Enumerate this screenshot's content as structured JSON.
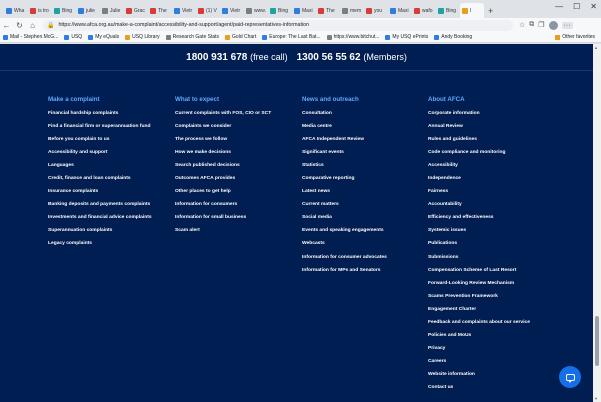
{
  "browser": {
    "tabs": [
      {
        "label": "Wha",
        "color": "#2f7de1"
      },
      {
        "label": "is tro",
        "color": "#d93b3b"
      },
      {
        "label": "Bing",
        "color": "#1fa2a2"
      },
      {
        "label": "julie",
        "color": "#2f7de1"
      },
      {
        "label": "Julie",
        "color": "#7d7d7d"
      },
      {
        "label": "Grac",
        "color": "#d93b3b"
      },
      {
        "label": "The",
        "color": "#d93b3b"
      },
      {
        "label": "Vietr",
        "color": "#2f7de1"
      },
      {
        "label": "(1) V",
        "color": "#d93b3b"
      },
      {
        "label": "Vietr",
        "color": "#2f7de1"
      },
      {
        "label": "www.",
        "color": "#7d7d7d"
      },
      {
        "label": "Bing",
        "color": "#1fa2a2"
      },
      {
        "label": "Maxi",
        "color": "#2f7de1"
      },
      {
        "label": "The",
        "color": "#d93b3b"
      },
      {
        "label": "mem",
        "color": "#7d7d7d"
      },
      {
        "label": "you",
        "color": "#d93b3b"
      },
      {
        "label": "Maxi",
        "color": "#2f7de1"
      },
      {
        "label": "wafo",
        "color": "#d93b3b"
      },
      {
        "label": "Bing",
        "color": "#1fa2a2"
      },
      {
        "label": "I",
        "color": "#e6a11a",
        "active": true
      }
    ],
    "new_tab": "+",
    "window_controls": {
      "minimize": "—",
      "maximize": "☐",
      "close": "✕"
    },
    "nav": {
      "back": "←",
      "refresh": "↻",
      "home": "⌂",
      "lock": "🔒"
    },
    "url": "https://www.afca.org.au/make-a-complaint/accessibility-and-support/agent/paid-representatives-information",
    "nav_right": {
      "star": "☆",
      "ext": "⧉",
      "collections": "❐",
      "more": "···"
    },
    "bookmarks": [
      {
        "label": "Mail - Stephen.McG...",
        "color": "#2f7de1"
      },
      {
        "label": "USQ",
        "color": "#2f7de1"
      },
      {
        "label": "My eQuals",
        "color": "#2f7de1"
      },
      {
        "label": "USQ Library",
        "color": "#e6a11a"
      },
      {
        "label": "Research Gate Stats",
        "color": "#7d7d7d"
      },
      {
        "label": "Gold Chart",
        "color": "#e6a11a"
      },
      {
        "label": "Europe: The Last Bat...",
        "color": "#2f7de1"
      },
      {
        "label": "https://www.bitchut...",
        "color": "#7d7d7d"
      },
      {
        "label": "My USQ ePrints",
        "color": "#2f7de1"
      },
      {
        "label": "Andy Booking",
        "color": "#2f7de1"
      }
    ],
    "other_favorites": "Other favorites"
  },
  "footer": {
    "phones": {
      "free_number": "1800 931 678",
      "free_label": "(free call)",
      "members_number": "1300 56 55 62",
      "members_label": "(Members)"
    },
    "columns": [
      {
        "heading": "Make a complaint",
        "links": [
          "Financial hardship complaints",
          "Find a financial firm or superannuation fund",
          "Before you complain to us",
          "Accessibility and support",
          "Languages",
          "Credit, finance and loan complaints",
          "Insurance complaints",
          "Banking deposits and payments complaints",
          "Investments and financial advice complaints",
          "Superannuation complaints",
          "Legacy complaints"
        ]
      },
      {
        "heading": "What to expect",
        "links": [
          "Current complaints with FOS, CIO or SCT",
          "Complaints we consider",
          "The process we follow",
          "How we make decisions",
          "Search published decisions",
          "Outcomes AFCA provides",
          "Other places to get help",
          "Information for consumers",
          "Information for small business",
          "Scam alert"
        ]
      },
      {
        "heading": "News and outreach",
        "links": [
          "Consultation",
          "Media centre",
          "AFCA Independent Review",
          "Significant events",
          "Statistics",
          "Comparative reporting",
          "Latest news",
          "Current matters",
          "Social media",
          "Events and speaking engagements",
          "Webcasts",
          "Information for consumer advocates",
          "Information for MPs and Senators"
        ]
      },
      {
        "heading": "About AFCA",
        "links": [
          "Corporate information",
          "Annual Review",
          "Rules and guidelines",
          "Code compliance and monitoring",
          "Accessibility",
          "Independence",
          "Fairness",
          "Accountability",
          "Efficiency and effectiveness",
          "Systemic issues",
          "Publications",
          "Submissions",
          "Compensation Scheme of Last Resort",
          "Forward-Looking Review Mechanism",
          "Scams Prevention Framework",
          "Engagement Charter",
          "Feedback and complaints about our service",
          "Policies and MoUs",
          "Privacy",
          "Careers",
          "Website information",
          "Contact us"
        ]
      }
    ]
  }
}
